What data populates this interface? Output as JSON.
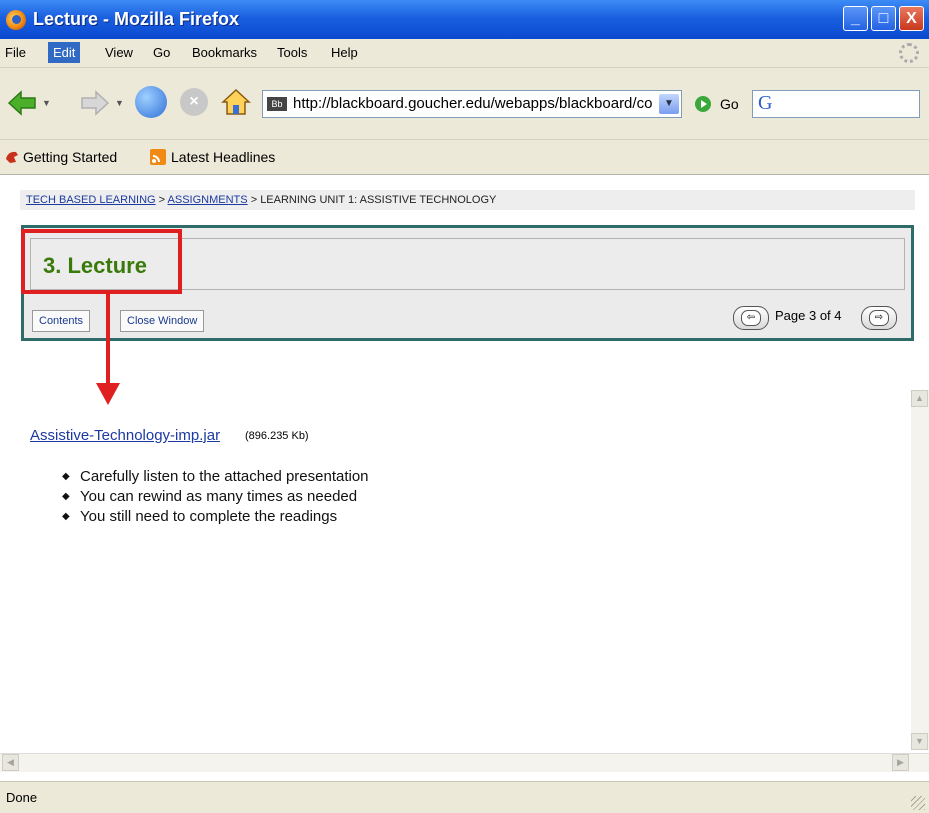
{
  "window": {
    "title": "Lecture - Mozilla Firefox",
    "buttons": {
      "minimize": "_",
      "maximize": "□",
      "close": "X"
    }
  },
  "menu": [
    "File",
    "Edit",
    "View",
    "Go",
    "Bookmarks",
    "Tools",
    "Help"
  ],
  "nav": {
    "url": "http://blackboard.goucher.edu/webapps/blackboard/conl",
    "go_label": "Go",
    "search_icon": "google-g-icon"
  },
  "bookmarks": [
    "Getting Started",
    "Latest Headlines"
  ],
  "breadcrumb": {
    "items": [
      "TECH BASED LEARNING",
      "ASSIGNMENTS",
      "LEARNING UNIT 1: ASSISTIVE TECHNOLOGY"
    ],
    "separator": ">"
  },
  "panel": {
    "title": "3. Lecture",
    "contents_label": "Contents",
    "close_label": "Close Window",
    "page_label": "Page 3 of 4"
  },
  "attachment": {
    "name": "Assistive-Technology-imp.jar",
    "size": "(896.235 Kb)"
  },
  "bullets": [
    "Carefully listen to the attached presentation",
    "You can rewind as many times as needed",
    "You still need to complete the readings"
  ],
  "status": "Done",
  "colors": {
    "annotation": "#e02020",
    "panel_border": "#2f6b69",
    "title_green": "#3a7a0a",
    "link_blue": "#1c3aa0"
  }
}
